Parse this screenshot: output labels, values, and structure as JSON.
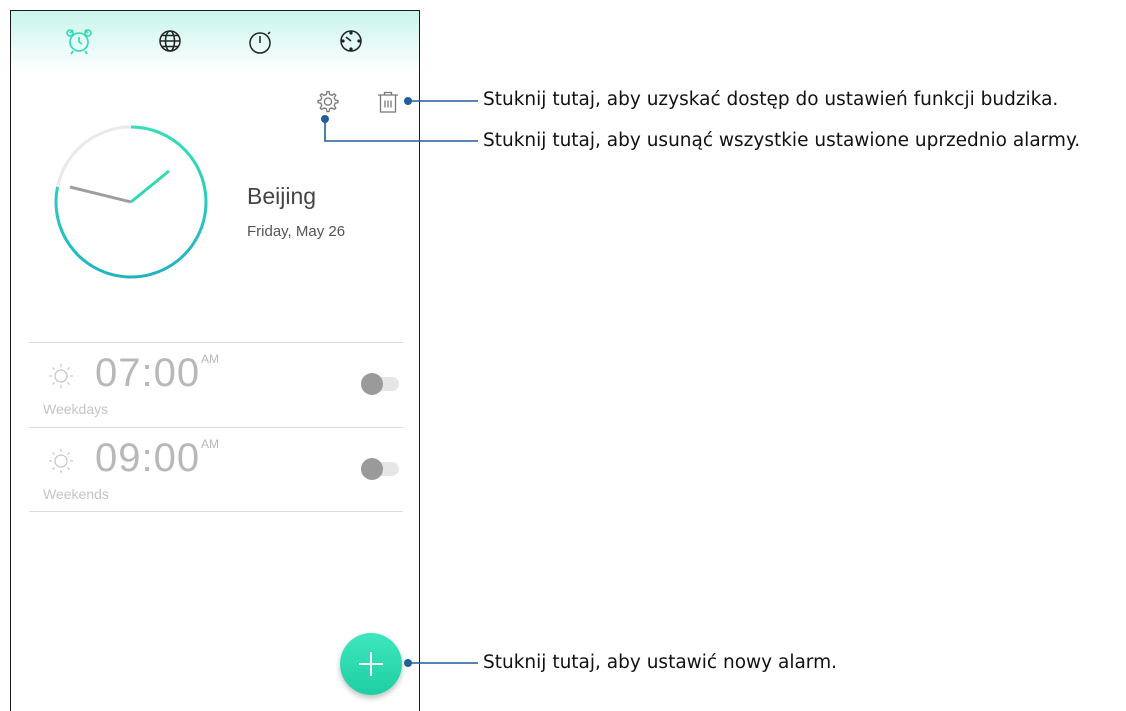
{
  "tabs": [
    {
      "name": "alarm",
      "icon": "alarm-clock-icon"
    },
    {
      "name": "world-clock",
      "icon": "globe-icon"
    },
    {
      "name": "stopwatch",
      "icon": "stopwatch-icon"
    },
    {
      "name": "timer",
      "icon": "timer-icon"
    }
  ],
  "toolbar": {
    "settings_icon": "gear-icon",
    "delete_icon": "trash-icon"
  },
  "clock": {
    "city": "Beijing",
    "date": "Friday, May 26"
  },
  "alarms": [
    {
      "time": "07:00",
      "ampm": "AM",
      "repeat": "Weekdays",
      "enabled": false
    },
    {
      "time": "09:00",
      "ampm": "AM",
      "repeat": "Weekends",
      "enabled": false
    }
  ],
  "fab": {
    "icon": "plus-icon"
  },
  "callouts": {
    "settings": "Stuknij tutaj, aby uzyskać dostęp do ustawień funkcji budzika.",
    "delete": "Stuknij tutaj, aby usunąć wszystkie ustawione uprzednio alarmy.",
    "add": "Stuknij tutaj, aby ustawić nowy alarm."
  },
  "colors": {
    "accent": "#2fd9b5",
    "callout_line": "#1f5f9a"
  }
}
